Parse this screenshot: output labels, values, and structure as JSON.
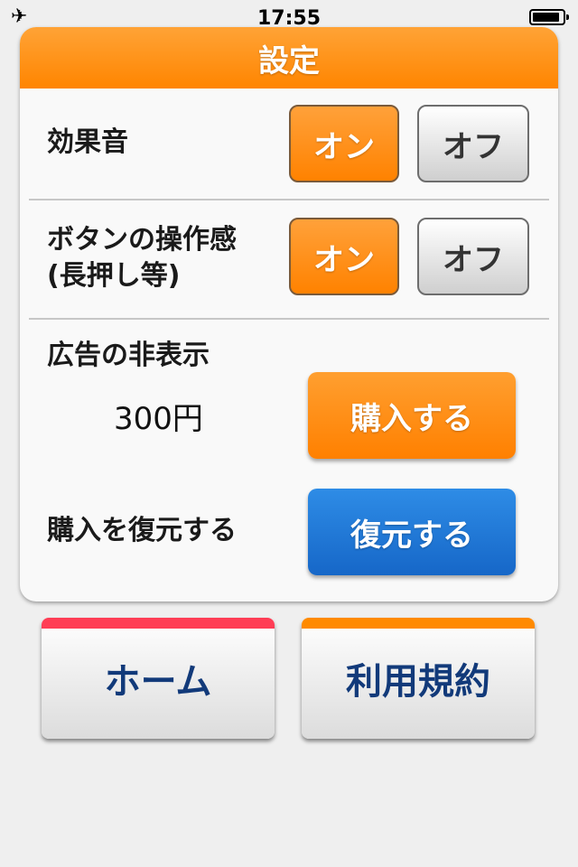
{
  "status_bar": {
    "time": "17:55",
    "airplane_icon": "airplane-icon",
    "battery_icon": "battery-icon",
    "battery_level": 0.9
  },
  "settings": {
    "title": "設定",
    "sound_effects": {
      "label": "効果音",
      "on_label": "オン",
      "off_label": "オフ"
    },
    "button_feel": {
      "label_line1": "ボタンの操作感",
      "label_line2": "(長押し等)",
      "on_label": "オン",
      "off_label": "オフ"
    },
    "hide_ads": {
      "label": "広告の非表示",
      "price": "300円",
      "buy_label": "購入する"
    },
    "restore": {
      "label": "購入を復元する",
      "button_label": "復元する"
    }
  },
  "nav": {
    "home": {
      "label": "ホーム",
      "accent": "#ff3d55"
    },
    "terms": {
      "label": "利用規約",
      "accent": "#ff8a00"
    }
  },
  "colors": {
    "header": "#ff8a00",
    "on_button": "#ff8a00",
    "restore_button": "#1e78d8",
    "nav_text": "#123a7a"
  }
}
